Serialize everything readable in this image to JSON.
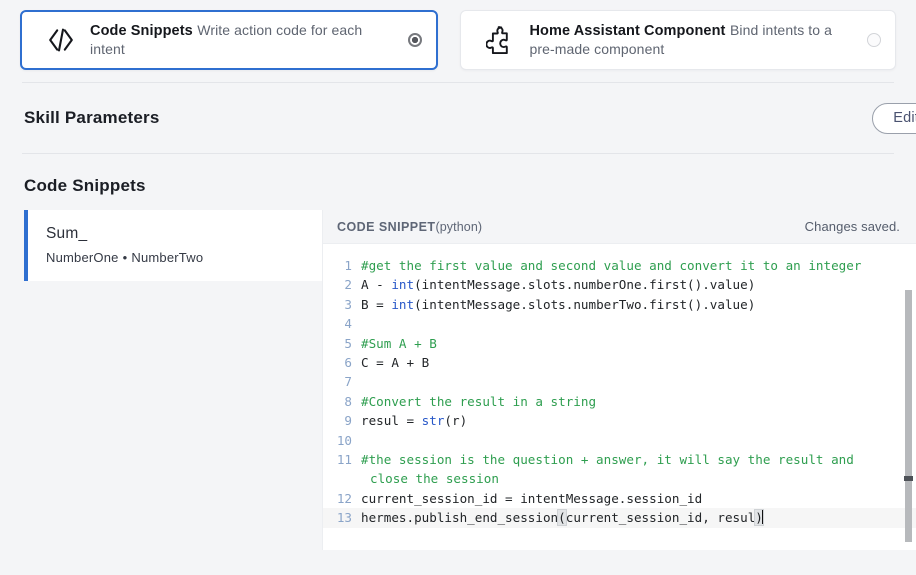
{
  "mode_cards": [
    {
      "icon": "code-brackets-icon",
      "title": "Code Snippets",
      "subtitle": "Write action code for each intent",
      "selected": true
    },
    {
      "icon": "puzzle-piece-icon",
      "title": "Home Assistant Component",
      "subtitle": "Bind intents to a pre-made component",
      "selected": false
    }
  ],
  "skill_parameters": {
    "title": "Skill Parameters",
    "edit_label": "Edit"
  },
  "code_snippets": {
    "title": "Code Snippets",
    "items": [
      {
        "name": "Sum_",
        "slot_one": "NumberOne",
        "separator": "•",
        "slot_two": "NumberTwo"
      }
    ],
    "editor": {
      "label": "CODE SNIPPET",
      "language": "(python)",
      "status": "Changes saved.",
      "lines": [
        {
          "n": "1",
          "text": "#get the first value and second value and convert it to an integer"
        },
        {
          "n": "2",
          "text": "A - int(intentMessage.slots.numberOne.first().value)"
        },
        {
          "n": "3",
          "text": "B = int(intentMessage.slots.numberTwo.first().value)"
        },
        {
          "n": "4",
          "text": ""
        },
        {
          "n": "5",
          "text": "#Sum A + B"
        },
        {
          "n": "6",
          "text": "C = A + B"
        },
        {
          "n": "7",
          "text": ""
        },
        {
          "n": "8",
          "text": "#Convert the result in a string"
        },
        {
          "n": "9",
          "text": "resul = str(r)"
        },
        {
          "n": "10",
          "text": ""
        },
        {
          "n": "11",
          "text": "#the session is the question + answer, it will say the result and close the session"
        },
        {
          "n": "12",
          "text": "current_session_id = intentMessage.session_id"
        },
        {
          "n": "13",
          "text": "hermes.publish_end_session(current_session_id, resul)"
        }
      ],
      "line11_wrap_a": "#the session is the question + answer, it will say the result and",
      "line11_wrap_b": "close the session",
      "line1_text": "#get the first value and second value and convert it to an integer",
      "line2_a": "A - ",
      "line2_kw": "int",
      "line2_b": "(intentMessage.slots.numberOne.first().value)",
      "line3_a": "B = ",
      "line3_kw": "int",
      "line3_b": "(intentMessage.slots.numberTwo.first().value)",
      "line5_text": "#Sum A + B",
      "line6_text": "C = A + B",
      "line8_text": "#Convert the result in a string",
      "line9_a": "resul = ",
      "line9_kw": "str",
      "line9_b": "(r)",
      "line12_text": "current_session_id = intentMessage.session_id",
      "line13_a": "hermes.publish_end_session",
      "line13_open": "(",
      "line13_mid": "current_session_id, resul",
      "line13_close": ")"
    }
  },
  "colors": {
    "accent_blue": "#2f6fd0",
    "page_bg": "#f4f5f7",
    "comment_green": "#2e9e4f",
    "keyword_blue": "#2858c8",
    "gutter_blue": "#8aa4c8"
  }
}
